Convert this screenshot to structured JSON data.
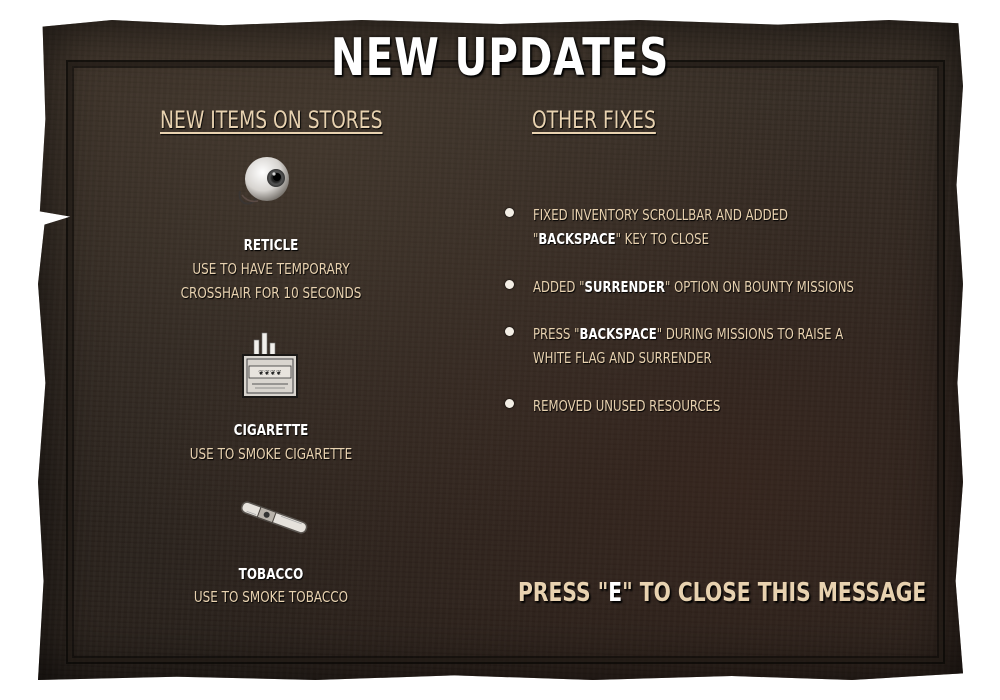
{
  "title": "NEW UPDATES",
  "left_column": {
    "heading": "NEW ITEMS ON STORES",
    "items": [
      {
        "icon": "eyeball-icon",
        "name": "RETICLE",
        "description": "USE TO HAVE TEMPORARY\nCROSSHAIR FOR 10 SECONDS"
      },
      {
        "icon": "cigarette-pack-icon",
        "name": "CIGARETTE",
        "description": "USE TO SMOKE CIGARETTE"
      },
      {
        "icon": "tobacco-roll-icon",
        "name": "TOBACCO",
        "description": "USE TO SMOKE TOBACCO"
      }
    ]
  },
  "right_column": {
    "heading": "OTHER FIXES",
    "fixes": [
      {
        "before": "FIXED INVENTORY SCROLLBAR AND ADDED\n\"",
        "highlight": "BACKSPACE",
        "after": "\" KEY TO CLOSE"
      },
      {
        "before": "ADDED \"",
        "highlight": "SURRENDER",
        "after": "\" OPTION ON BOUNTY MISSIONS"
      },
      {
        "before": "PRESS \"",
        "highlight": "BACKSPACE",
        "after": "\" DURING MISSIONS TO  RAISE A\nWHITE FLAG AND SURRENDER"
      },
      {
        "before": "REMOVED UNUSED RESOURCES",
        "highlight": "",
        "after": ""
      }
    ]
  },
  "footer": {
    "close_before": "PRESS \"",
    "close_key": "E",
    "close_after": "\" TO CLOSE THIS MESSAGE"
  },
  "colors": {
    "panel": "#2e2620",
    "text_tan": "#e8d2b0",
    "text_white": "#ffffff"
  }
}
